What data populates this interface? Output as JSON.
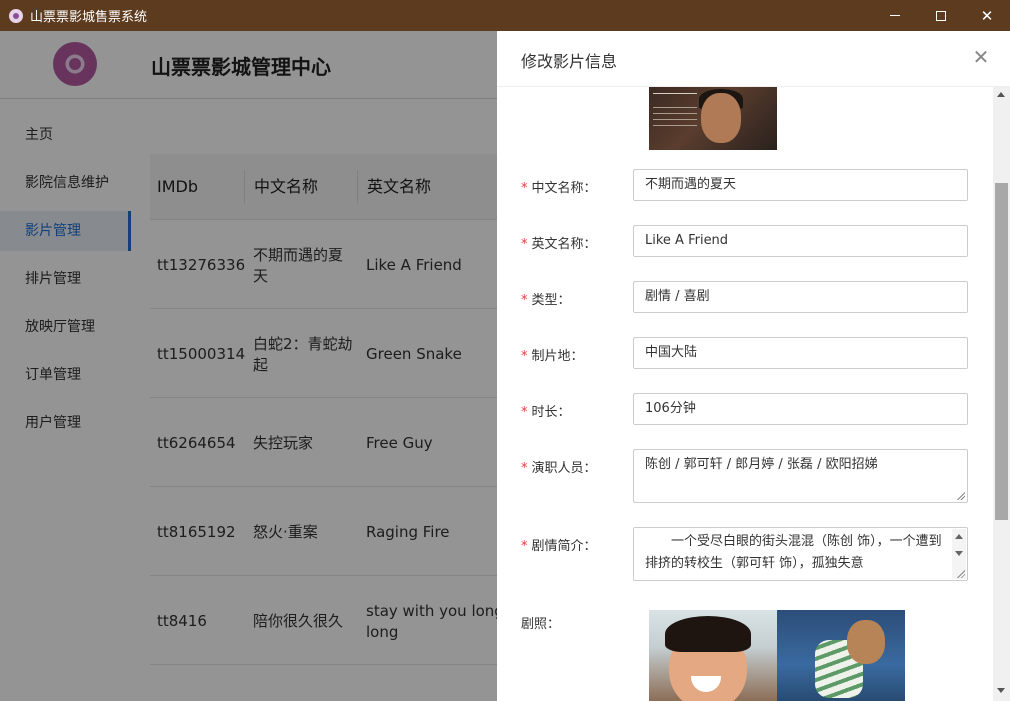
{
  "window": {
    "title": "山票票影城售票系统",
    "icon": "app-logo-icon"
  },
  "header": {
    "brand": "山票票影城管理中心"
  },
  "sidebar": {
    "items": [
      {
        "label": "主页",
        "active": false
      },
      {
        "label": "影院信息维护",
        "active": false
      },
      {
        "label": "影片管理",
        "active": true
      },
      {
        "label": "排片管理",
        "active": false
      },
      {
        "label": "放映厅管理",
        "active": false
      },
      {
        "label": "订单管理",
        "active": false
      },
      {
        "label": "用户管理",
        "active": false
      }
    ]
  },
  "table": {
    "columns": [
      "IMDb",
      "中文名称",
      "英文名称"
    ],
    "rows": [
      {
        "imdb": "tt13276336",
        "cn": "不期而遇的夏天",
        "en": "Like A Friend"
      },
      {
        "imdb": "tt15000314",
        "cn": "白蛇2：青蛇劫起",
        "en": "Green Snake"
      },
      {
        "imdb": "tt6264654",
        "cn": "失控玩家",
        "en": "Free Guy"
      },
      {
        "imdb": "tt8165192",
        "cn": "怒火·重案",
        "en": "Raging Fire"
      },
      {
        "imdb": "tt8416",
        "cn": "陪你很久很久",
        "en": "stay with you long long"
      }
    ]
  },
  "drawer": {
    "title": "修改影片信息",
    "close_icon": "close-icon",
    "fields": {
      "cn_name": {
        "label": "中文名称：",
        "value": "不期而遇的夏天"
      },
      "en_name": {
        "label": "英文名称：",
        "value": "Like A Friend"
      },
      "type": {
        "label": "类型：",
        "value": "剧情 / 喜剧"
      },
      "region": {
        "label": "制片地：",
        "value": "中国大陆"
      },
      "duration": {
        "label": "时长：",
        "value": "106分钟"
      },
      "cast": {
        "label": "演职人员：",
        "value": "陈创 / 郭可轩 / 郎月婷 / 张磊 / 欧阳招娣"
      },
      "synopsis": {
        "label": "剧情简介：",
        "value": "　　一个受尽白眼的街头混混（陈创 饰），一个遭到排挤的转校生（郭可轩 饰），孤独失意"
      }
    },
    "stills_label": "剧照："
  },
  "colors": {
    "titlebar": "#5c3b1e",
    "accent": "#1f6fd1",
    "required": "#e23b3b"
  }
}
